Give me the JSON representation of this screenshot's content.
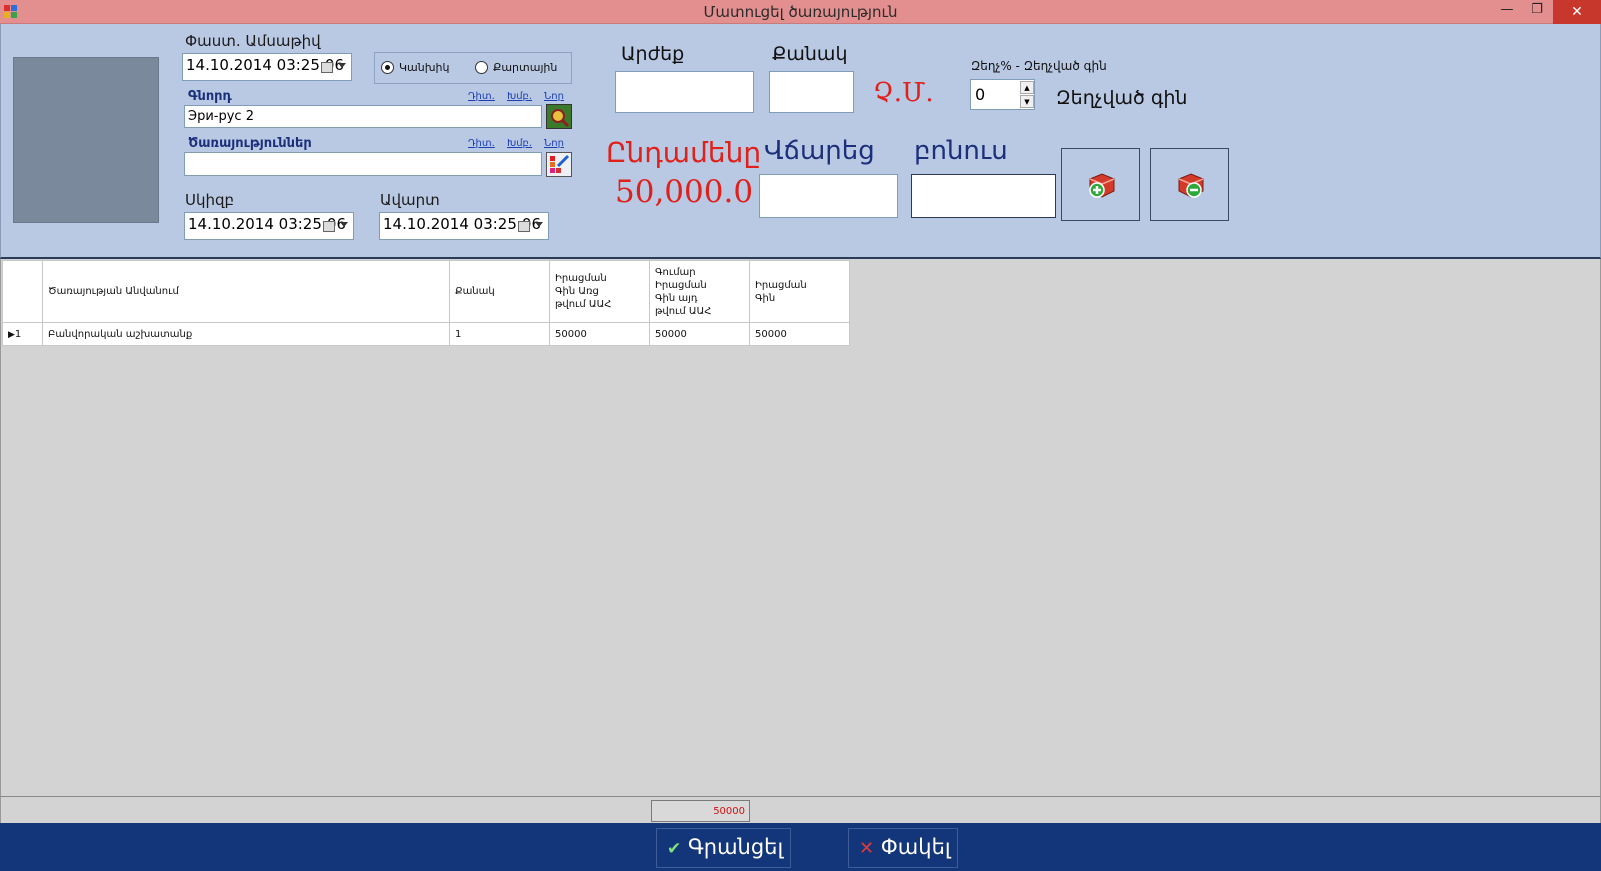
{
  "window": {
    "title": "Մատուցել ծառայություն",
    "minimize_glyph": "—",
    "restore_glyph": "❐",
    "close_glyph": "✕"
  },
  "form": {
    "doc_date_label": "Փաստ. Ամսաթիվ",
    "doc_date_value": "14.10.2014 03:25:06",
    "payment_options": [
      "Կանխիկ",
      "Քարտային"
    ],
    "payment_selected": "Կանխիկ",
    "client_label": "Գնորդ",
    "client_value": "Эри-рус 2",
    "links": [
      "Դիտ.",
      "Խմբ.",
      "Նոր"
    ],
    "services_label": "Ծառայություններ",
    "services_value": "",
    "start_label": "Սկիզբ",
    "start_value": "14.10.2014 03:25:06",
    "end_label": "Ավարտ",
    "end_value": "14.10.2014 03:25:06",
    "price_label": "Արժեք",
    "quantity_label": "Քանակ",
    "unit_label": "Չ.Մ.",
    "discount_label": "Զեղչ% - Զեղչված գին",
    "discount_value": "0",
    "discounted_price_label": "Զեղչված գին",
    "total_label": "Ընդամենը",
    "total_value": "50,000.0",
    "paid_label": "Վճարեց",
    "bonus_label": "բոնուս"
  },
  "grid": {
    "columns": [
      "Ծառայության Անվանում",
      "Քանակ",
      "Իրացման Գին Առց թվում ԱԱՀ",
      "Գումար Իրացման Գին այդ թվում ԱԱՀ",
      "Իրացման Գին"
    ],
    "rows": [
      {
        "index": "1",
        "cells": [
          "Բանվորական աշխատանք",
          "1",
          "50000",
          "50000",
          "50000"
        ]
      }
    ],
    "summary_total": "50000"
  },
  "footer": {
    "save_label": "Գրանցել",
    "close_label": "Փակել"
  },
  "colors": {
    "titlebar": "#e38f8f",
    "panel": "#b9c9e3",
    "accent_red": "#e0201a",
    "navy": "#1c2f7a",
    "footer": "#13367a"
  }
}
